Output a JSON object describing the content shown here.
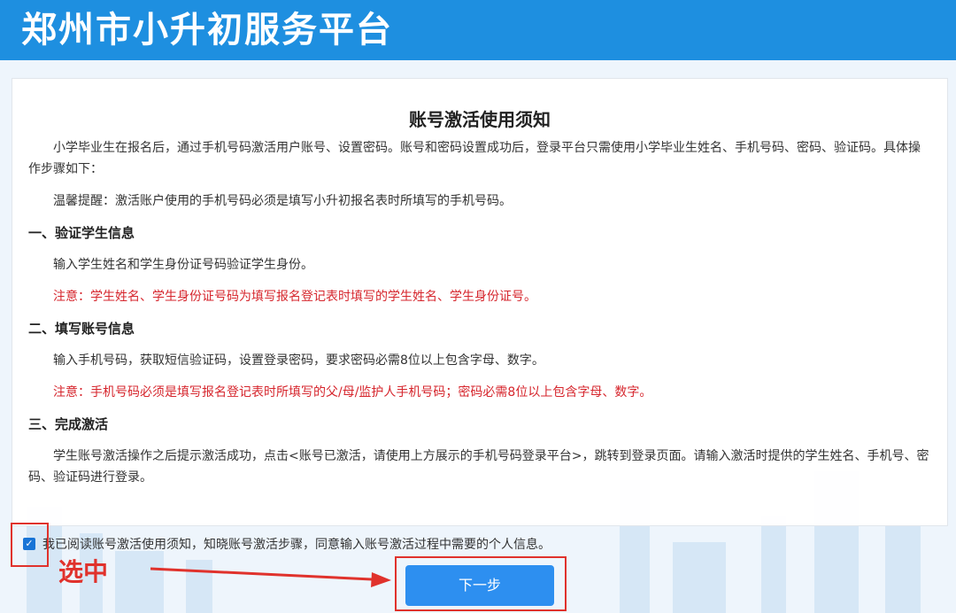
{
  "header": {
    "title": "郑州市小升初服务平台"
  },
  "notice": {
    "title": "账号激活使用须知",
    "intro": "小学毕业生在报名后，通过手机号码激活用户账号、设置密码。账号和密码设置成功后，登录平台只需使用小学毕业生姓名、手机号码、密码、验证码。具体操作步骤如下：",
    "tip": "温馨提醒：激活账户使用的手机号码必须是填写小升初报名表时所填写的手机号码。",
    "sections": [
      {
        "title": "一、验证学生信息",
        "text": "输入学生姓名和学生身份证号码验证学生身份。",
        "note": "注意：学生姓名、学生身份证号码为填写报名登记表时填写的学生姓名、学生身份证号。"
      },
      {
        "title": "二、填写账号信息",
        "text": "输入手机号码，获取短信验证码，设置登录密码，要求密码必需8位以上包含字母、数字。",
        "note": "注意：手机号码必须是填写报名登记表时所填写的父/母/监护人手机号码；密码必需8位以上包含字母、数字。"
      },
      {
        "title": "三、完成激活",
        "text": "学生账号激活操作之后提示激活成功，点击<账号已激活，请使用上方展示的手机号码登录平台>，跳转到登录页面。请输入激活时提供的学生姓名、手机号、密码、验证码进行登录。"
      }
    ]
  },
  "agree": {
    "checked": true,
    "label": "我已阅读账号激活使用须知，知晓账号激活步骤，同意输入账号激活过程中需要的个人信息。"
  },
  "annotation": {
    "text": "选中",
    "color": "#e0322c"
  },
  "next_button": {
    "label": "下一步",
    "color": "#2d8ff0"
  }
}
